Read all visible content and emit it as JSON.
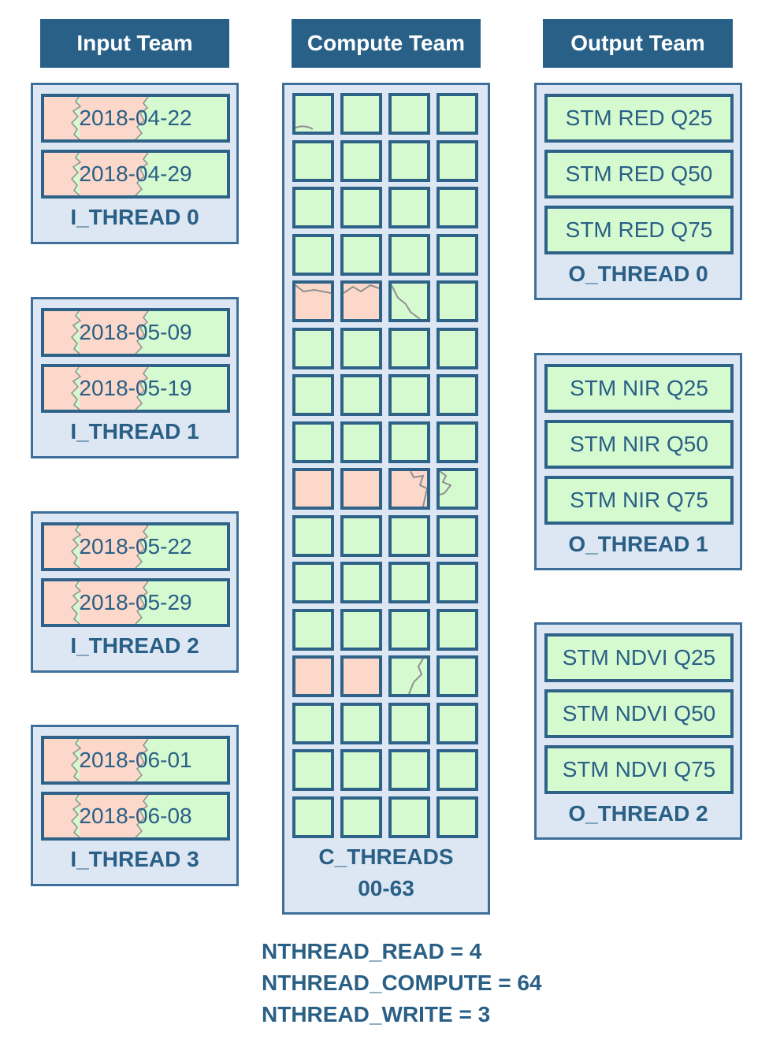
{
  "headers": {
    "input": "Input Team",
    "compute": "Compute Team",
    "output": "Output Team"
  },
  "input_threads": [
    {
      "label": "I_THREAD 0",
      "dates": [
        "2018-04-22",
        "2018-04-29"
      ]
    },
    {
      "label": "I_THREAD 1",
      "dates": [
        "2018-05-09",
        "2018-05-19"
      ]
    },
    {
      "label": "I_THREAD 2",
      "dates": [
        "2018-05-22",
        "2018-05-29"
      ]
    },
    {
      "label": "I_THREAD 3",
      "dates": [
        "2018-06-01",
        "2018-06-08"
      ]
    }
  ],
  "compute": {
    "label_line1": "C_THREADS",
    "label_line2": "00-63"
  },
  "output_threads": [
    {
      "label": "O_THREAD 0",
      "products": [
        "STM RED Q25",
        "STM RED Q50",
        "STM RED Q75"
      ]
    },
    {
      "label": "O_THREAD 1",
      "products": [
        "STM NIR Q25",
        "STM NIR Q50",
        "STM NIR Q75"
      ]
    },
    {
      "label": "O_THREAD 2",
      "products": [
        "STM NDVI Q25",
        "STM NDVI Q50",
        "STM NDVI Q75"
      ]
    }
  ],
  "formulas": [
    "NTHREAD_READ = 4",
    "NTHREAD_COMPUTE = 64",
    "NTHREAD_WRITE = 3"
  ],
  "colors": {
    "header_bg": "#286088",
    "panel_bg": "#dde7f4",
    "border": "#2f6289",
    "text": "#2a5f86",
    "land_green": "#d5fad0",
    "land_red": "#fbd8c9"
  }
}
